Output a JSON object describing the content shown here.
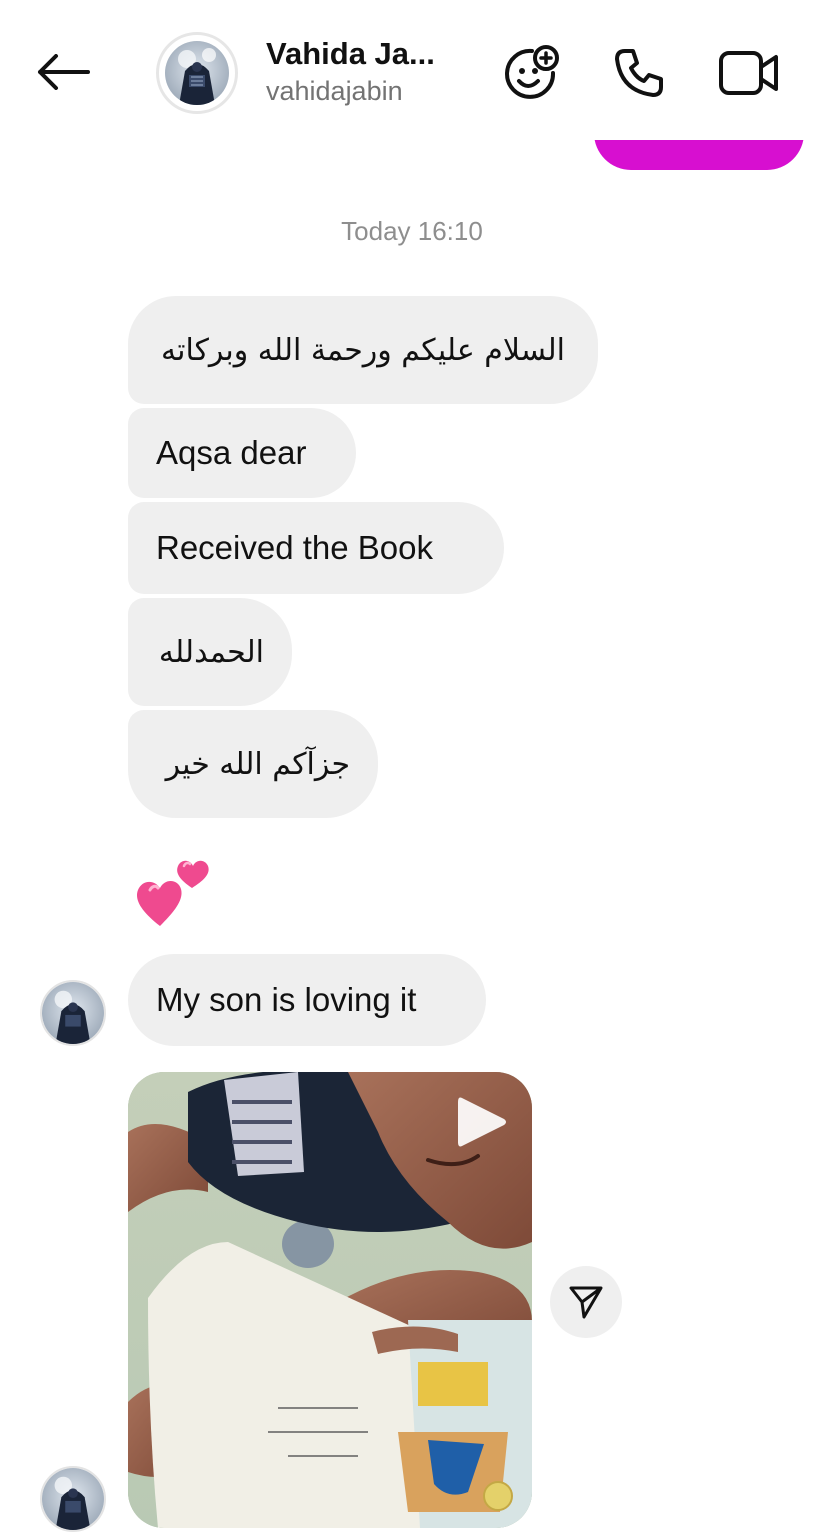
{
  "header": {
    "back_icon": "arrow-left-icon",
    "contact_name": "Vahida Ja...",
    "contact_handle": "vahidajabin",
    "actions": [
      {
        "icon": "sticker-add-icon"
      },
      {
        "icon": "phone-icon"
      },
      {
        "icon": "video-camera-icon"
      }
    ]
  },
  "thread": {
    "timestamp": "Today 16:10",
    "messages": [
      {
        "text": "السلام عليكم ورحمة الله وبركاته"
      },
      {
        "text": "Aqsa dear"
      },
      {
        "text": "Received the Book"
      },
      {
        "text": "الحمدلله"
      },
      {
        "text": "جزآكم الله خير"
      },
      {
        "text": "My son is loving it"
      }
    ],
    "reaction": "two-hearts-icon",
    "video": {
      "icon": "play-icon"
    },
    "share_icon": "send-icon"
  },
  "colors": {
    "outgoing_bubble": "#d70fd0",
    "incoming_bubble": "#efefef",
    "timestamp": "#8e8e8e",
    "handle": "#737373"
  }
}
